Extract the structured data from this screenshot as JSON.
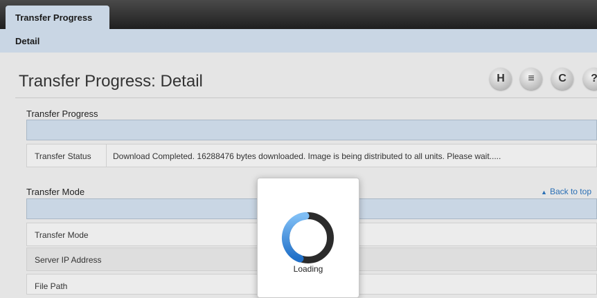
{
  "nav": {
    "tab": "Transfer Progress",
    "sub_item": "Detail"
  },
  "header": {
    "title": "Transfer Progress: Detail",
    "toolbar": [
      {
        "icon": "save-icon",
        "glyph": "H"
      },
      {
        "icon": "print-icon",
        "glyph": "≡"
      },
      {
        "icon": "refresh-icon",
        "glyph": "C"
      },
      {
        "icon": "help-icon",
        "glyph": "?"
      }
    ]
  },
  "sections": {
    "progress": {
      "label": "Transfer Progress",
      "rows": [
        {
          "key": "Transfer Status",
          "value": "Download Completed. 16288476 bytes downloaded. Image is being distributed to all units. Please wait....."
        }
      ]
    },
    "mode": {
      "label": "Transfer Mode",
      "back_to_top": "Back to top",
      "rows": [
        {
          "key": "Transfer Mode",
          "value": ""
        },
        {
          "key": "Server IP Address",
          "value": ""
        },
        {
          "key": "File Path",
          "value": ""
        }
      ]
    }
  },
  "loading": {
    "text": "Loading"
  },
  "colors": {
    "tabbar_dark": "#2a2a2a",
    "nav_blue": "#c9d6e4",
    "link_blue": "#2a6fb5",
    "spinner_blue": "#1f77d0"
  }
}
